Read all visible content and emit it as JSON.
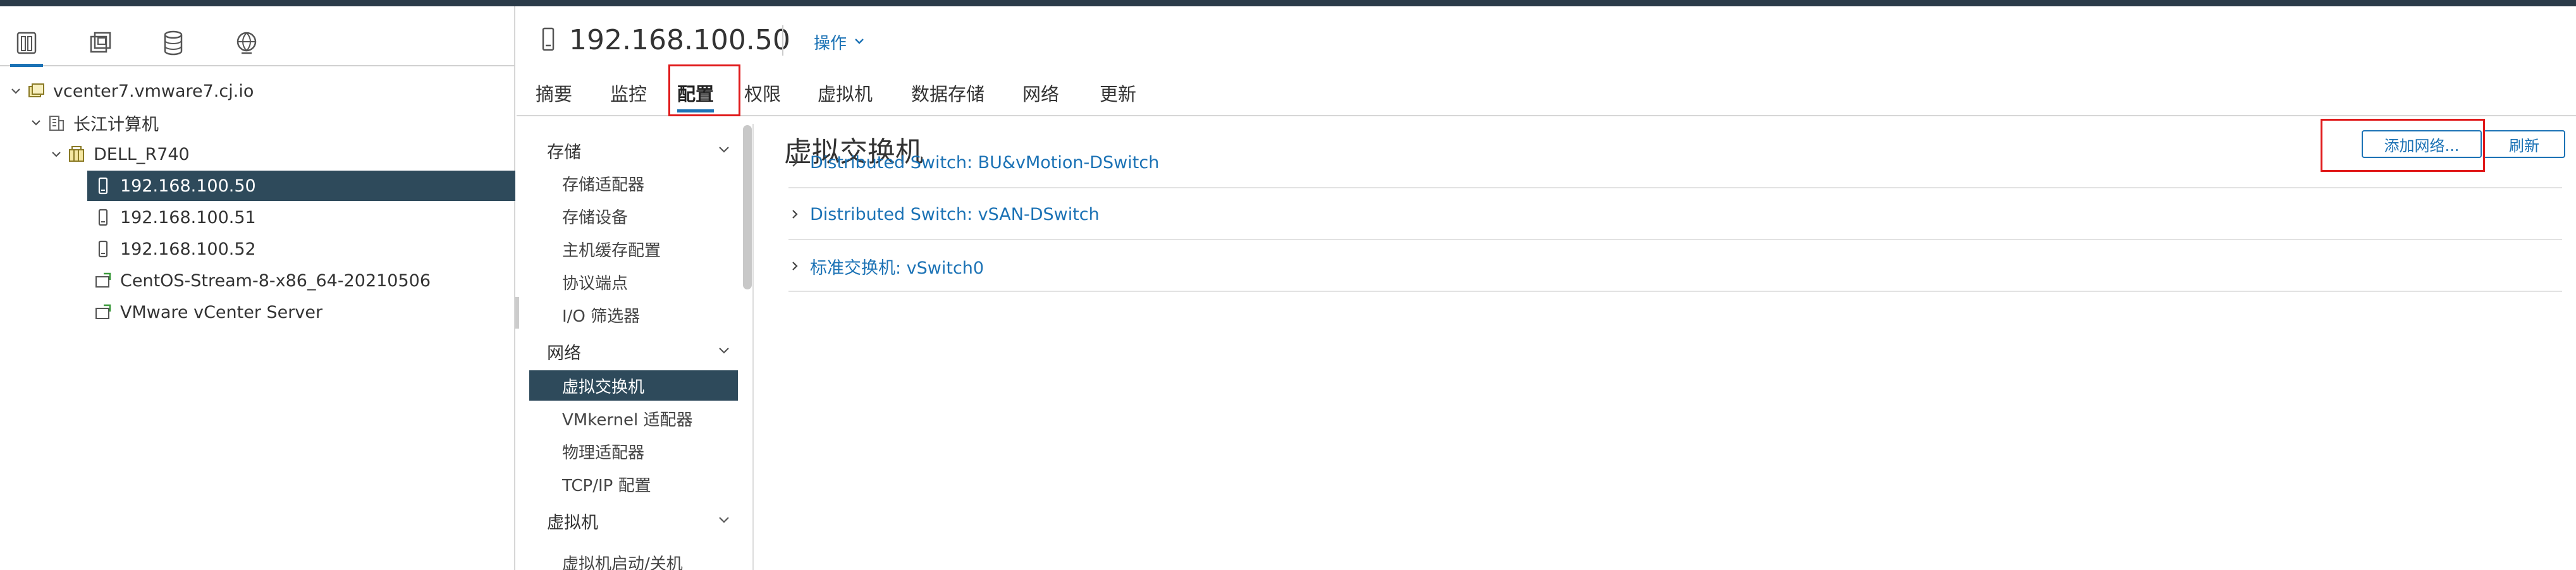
{
  "tree": {
    "items": [
      {
        "label": "vcenter7.vmware7.cj.io",
        "icon": "vcenter-icon"
      },
      {
        "label": "长江计算机",
        "icon": "datacenter-icon"
      },
      {
        "label": "DELL_R740",
        "icon": "cluster-icon"
      },
      {
        "label": "192.168.100.50",
        "icon": "host-icon"
      },
      {
        "label": "192.168.100.51",
        "icon": "host-icon"
      },
      {
        "label": "192.168.100.52",
        "icon": "host-icon"
      },
      {
        "label": "CentOS-Stream-8-x86_64-20210506",
        "icon": "vm-icon"
      },
      {
        "label": "VMware vCenter Server",
        "icon": "vm-icon"
      }
    ]
  },
  "header": {
    "host_name": "192.168.100.50",
    "actions_label": "操作",
    "tabs": [
      "摘要",
      "监控",
      "配置",
      "权限",
      "虚拟机",
      "数据存储",
      "网络",
      "更新"
    ],
    "active_tab": "配置"
  },
  "nav": {
    "sections": [
      {
        "label": "存储",
        "items": [
          "存储适配器",
          "存储设备",
          "主机缓存配置",
          "协议端点",
          "I/O 筛选器"
        ]
      },
      {
        "label": "网络",
        "items": [
          "虚拟交换机",
          "VMkernel 适配器",
          "物理适配器",
          "TCP/IP 配置"
        ]
      },
      {
        "label": "虚拟机",
        "items": [
          "虚拟机启动/关机"
        ]
      }
    ],
    "selected": "虚拟交换机"
  },
  "content": {
    "title": "虚拟交换机",
    "add_network_label": "添加网络...",
    "refresh_label": "刷新",
    "switches": [
      "Distributed Switch: BU&vMotion-DSwitch",
      "Distributed Switch: vSAN-DSwitch",
      "标准交换机: vSwitch0"
    ]
  },
  "colors": {
    "accent": "#1b72b5",
    "selected_bg": "#2e4a5b",
    "annotation": "#e0191a"
  }
}
